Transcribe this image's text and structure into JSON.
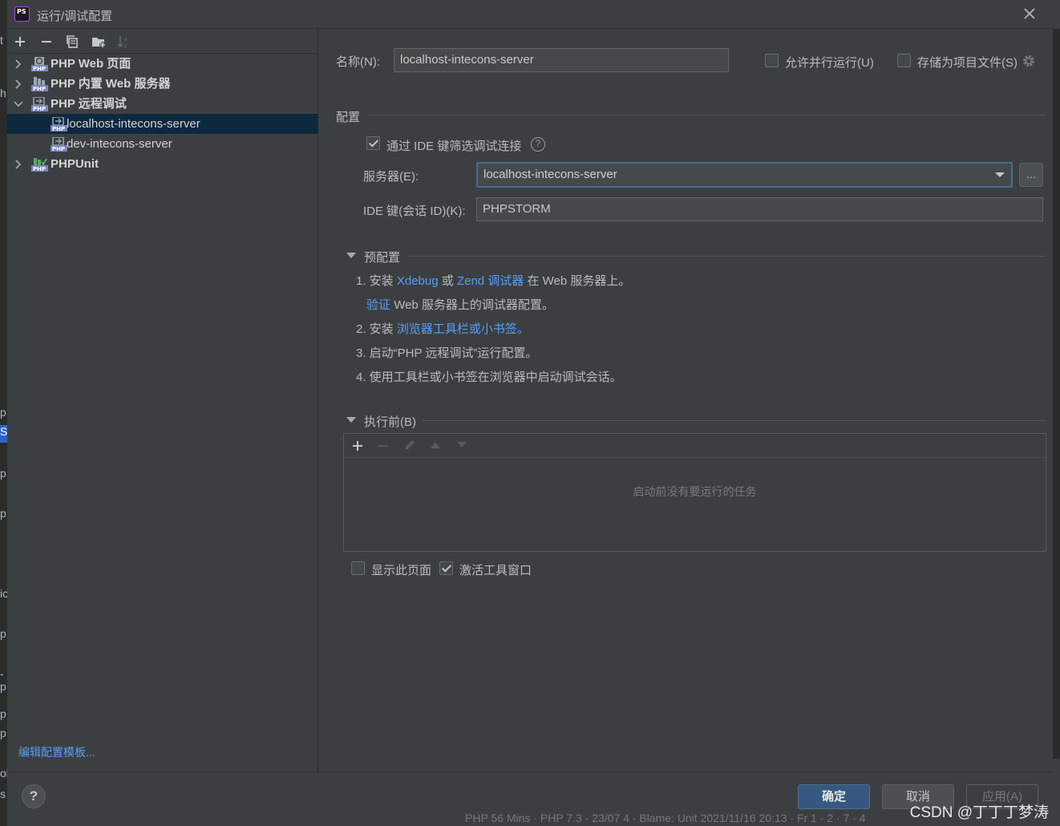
{
  "window": {
    "title": "运行/调试配置",
    "app_icon": "PS"
  },
  "left_edge_glyphs": [
    "t",
    "h",
    "p",
    "S",
    "p",
    "p",
    "ic",
    "p",
    "-p",
    "p",
    "p",
    "ol",
    "s"
  ],
  "left": {
    "toolbar": [
      "add-icon",
      "remove-icon",
      "copy-icon",
      "folder-add-icon",
      "sort-icon"
    ],
    "tree": [
      {
        "label": "PHP Web 页面",
        "expanded": false,
        "bold": true
      },
      {
        "label": "PHP 内置 Web 服务器",
        "expanded": false,
        "bold": true
      },
      {
        "label": "PHP 远程调试",
        "expanded": true,
        "bold": true
      },
      {
        "label": "localhost-intecons-server",
        "selected": true
      },
      {
        "label": "dev-intecons-server"
      },
      {
        "label": "PHPUnit",
        "expanded": false,
        "bold": true
      }
    ],
    "edit_templates": "编辑配置模板..."
  },
  "right": {
    "name_label": "名称(N):",
    "name_value": "localhost-intecons-server",
    "allow_parallel": "允许并行运行(U)",
    "store_as_project": "存储为项目文件(S)",
    "config_section": "配置",
    "filter_ide_key": "通过 IDE 键筛选调试连接",
    "server_label": "服务器(E):",
    "server_value": "localhost-intecons-server",
    "ellipsis": "...",
    "ide_key_label": "IDE 键(会话 ID)(K):",
    "ide_key_value": "PHPSTORM",
    "preconfig_section": "预配置",
    "steps": {
      "s1_prefix": "1. 安装",
      "s1_xdebug": "Xdebug",
      "s1_or": "或",
      "s1_zend": "Zend 调试器",
      "s1_suffix": "在 Web 服务器上。",
      "s1b_link": "验证",
      "s1b_text": "Web 服务器上的调试器配置。",
      "s2_prefix": "2. 安装",
      "s2_link": "浏览器工具栏或小书签。",
      "s3": "3. 启动“PHP 远程调试”运行配置。",
      "s4": "4. 使用工具栏或小书签在浏览器中启动调试会话。"
    },
    "before_launch_section": "执行前(B)",
    "before_launch_empty": "启动前没有要运行的任务",
    "show_page": "显示此页面",
    "activate_tool_window": "激活工具窗口"
  },
  "bottom": {
    "help": "?",
    "ok": "确定",
    "cancel": "取消",
    "apply": "应用(A)",
    "status_ghost": "PHP 56 Mins · PHP 7.3 · 23/07 4 · Blame: Unit 2021/11/16 20:13 · Fr 1 · 2 · 7 · 4",
    "watermark": "CSDN @丁丁丁梦涛"
  }
}
